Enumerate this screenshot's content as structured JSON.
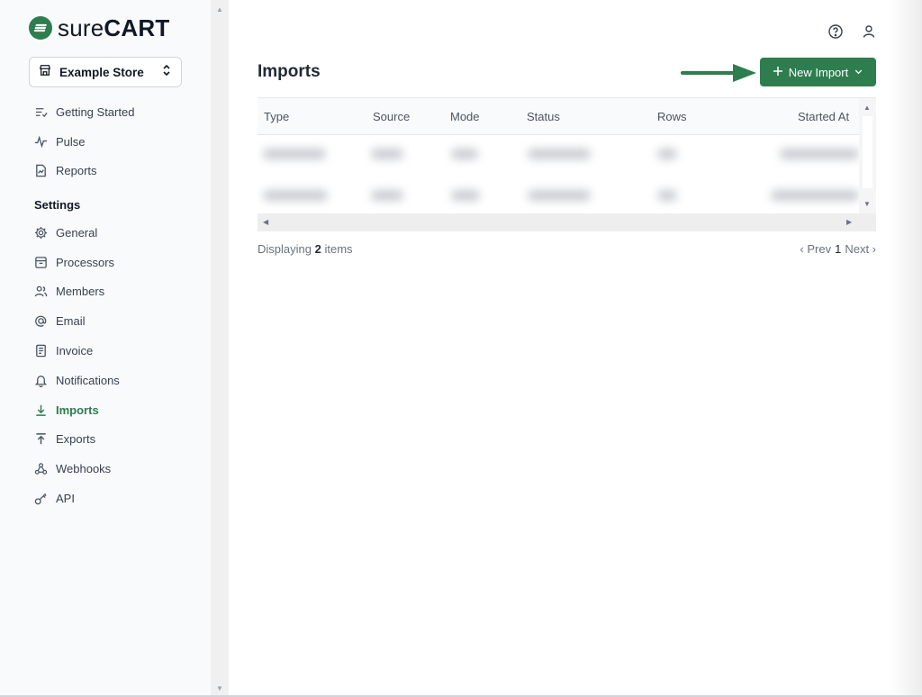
{
  "brand": {
    "name_light": "sure",
    "name_bold": "CART",
    "accent": "#2e7d4f"
  },
  "store_selector": {
    "label": "Example Store",
    "icon": "store-icon",
    "chevron": "chevron-up-down-icon"
  },
  "nav_top": [
    {
      "label": "Getting Started",
      "icon": "list-check-icon"
    },
    {
      "label": "Pulse",
      "icon": "pulse-icon"
    },
    {
      "label": "Reports",
      "icon": "report-icon"
    }
  ],
  "settings_heading": "Settings",
  "nav_settings": [
    {
      "label": "General",
      "icon": "gear-icon"
    },
    {
      "label": "Processors",
      "icon": "processor-icon"
    },
    {
      "label": "Members",
      "icon": "members-icon"
    },
    {
      "label": "Email",
      "icon": "at-icon"
    },
    {
      "label": "Invoice",
      "icon": "invoice-icon"
    },
    {
      "label": "Notifications",
      "icon": "bell-icon"
    },
    {
      "label": "Imports",
      "icon": "download-icon",
      "active": true
    },
    {
      "label": "Exports",
      "icon": "upload-icon"
    },
    {
      "label": "Webhooks",
      "icon": "webhook-icon"
    },
    {
      "label": "API",
      "icon": "key-icon"
    }
  ],
  "topbar": {
    "help_icon": "help-circle-icon",
    "user_icon": "user-icon"
  },
  "page": {
    "title": "Imports",
    "new_button": {
      "label": "New Import",
      "icon": "plus-icon",
      "chevron": "chevron-down-icon"
    }
  },
  "table": {
    "columns": [
      "Type",
      "Source",
      "Mode",
      "Status",
      "Rows",
      "Started At"
    ],
    "rows_blurred": 2
  },
  "footer": {
    "displaying_prefix": "Displaying",
    "count": "2",
    "displaying_suffix": "items",
    "pager": {
      "prev": "‹ Prev",
      "page": "1",
      "next": "Next ›"
    }
  }
}
